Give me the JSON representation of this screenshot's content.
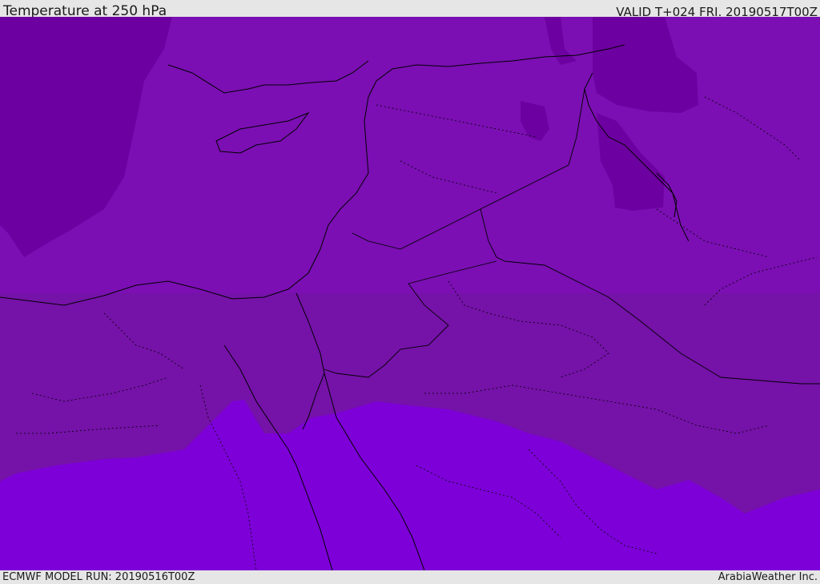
{
  "header": {
    "title": "Temperature at 250 hPa",
    "valid_time": "VALID T+024 FRI. 20190517T00Z"
  },
  "footer": {
    "model_run": "ECMWF MODEL RUN: 20190516T00Z",
    "credit": "ArabiaWeather Inc."
  },
  "colors": {
    "band_cold": "#6d00a0",
    "band_mid": "#7b0fb3",
    "band_lower": "#7512a8",
    "band_warm": "#7d00d8",
    "coast": "#000000"
  }
}
